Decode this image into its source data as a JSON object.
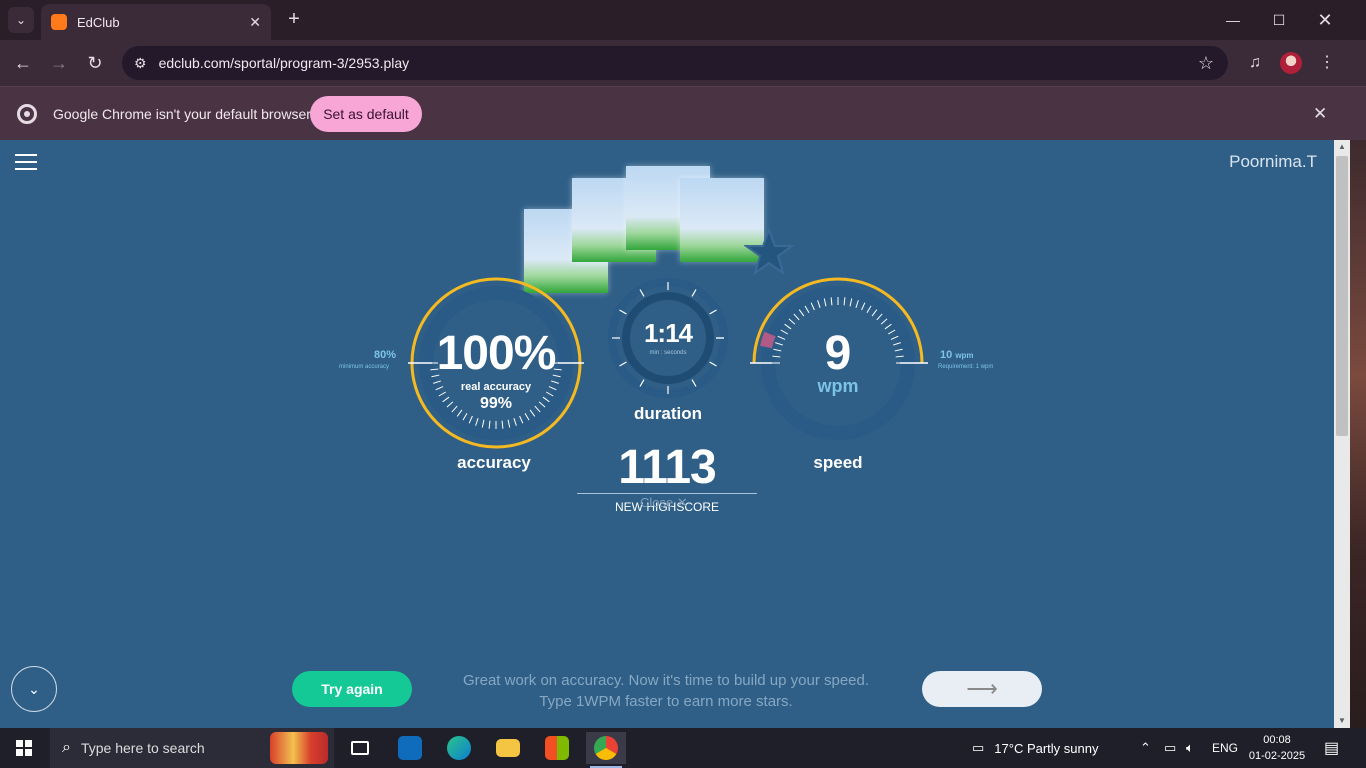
{
  "browser": {
    "tab_title": "EdClub",
    "tab_close": "✕",
    "new_tab": "+",
    "url": "edclub.com/sportal/program-3/2953.play",
    "infobar_message": "Google Chrome isn't your default browser",
    "set_default_label": "Set as default"
  },
  "page": {
    "username": "Poornima.T",
    "accuracy": {
      "value": "100%",
      "real_label": "real accuracy",
      "real_value": "99%",
      "label": "accuracy",
      "minimum_value": "80%",
      "minimum_label": "minimum accuracy",
      "fraction": 1.0
    },
    "duration": {
      "value": "1:14",
      "unit": "min : seconds",
      "label": "duration"
    },
    "speed": {
      "value": "9",
      "unit": "wpm",
      "label": "speed",
      "target_value": "10",
      "target_unit": "wpm",
      "requirement": "Requirement: 1 wpm"
    },
    "highscore": {
      "value": "1113",
      "label": "NEW HIGHSCORE",
      "close_hint": "Close ✕"
    },
    "try_again_label": "Try again",
    "feedback_line1": "Great work on accuracy. Now it's time to build up your speed.",
    "feedback_line2": "Type 1WPM faster to earn more stars.",
    "next_arrow": "⟶"
  },
  "taskbar": {
    "search_placeholder": "Type here to search",
    "weather": "17°C  Partly sunny",
    "language": "ENG",
    "time": "00:08",
    "date": "01-02-2025"
  },
  "colors": {
    "page_bg": "#2f5f87",
    "gauge_gold": "#f5b921",
    "gauge_track": "#2a5a86",
    "try_again": "#14c996",
    "set_default": "#f7a6d6"
  }
}
